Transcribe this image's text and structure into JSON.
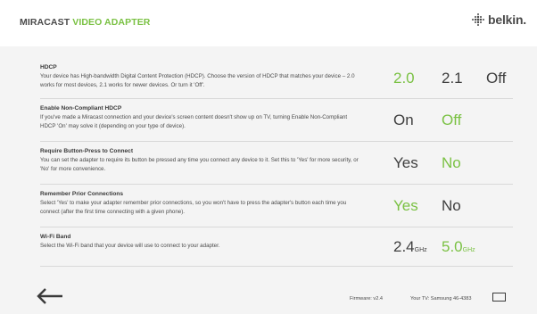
{
  "header": {
    "title_part1": "MIRACAST ",
    "title_part2": "VIDEO ADAPTER",
    "brand": "belkin."
  },
  "colors": {
    "accent": "#7ac143",
    "text": "#4a4a4a",
    "background": "#f4f4f4"
  },
  "settings": [
    {
      "title": "HDCP",
      "description": "Your device has High-bandwidth Digital Content Protection (HDCP). Choose the version of HDCP that matches your device – 2.0 works for most devices, 2.1 works for newer devices. Or turn it 'Off'.",
      "options": [
        {
          "label": "2.0",
          "selected": true
        },
        {
          "label": "2.1",
          "selected": false
        },
        {
          "label": "Off",
          "selected": false
        }
      ]
    },
    {
      "title": "Enable Non-Compliant HDCP",
      "description": "If you've made a Miracast connection and your device's screen content doesn't show up on TV, turning Enable Non-Compliant HDCP 'On' may solve it (depending on your type of device).",
      "options": [
        {
          "label": "On",
          "selected": false
        },
        {
          "label": "Off",
          "selected": true
        }
      ]
    },
    {
      "title": "Require Button-Press to Connect",
      "description": "You can set the adapter to require its button be pressed any time you connect any device to it. Set this to 'Yes' for more security, or 'No' for more convenience.",
      "options": [
        {
          "label": "Yes",
          "selected": false
        },
        {
          "label": "No",
          "selected": true
        }
      ]
    },
    {
      "title": "Remember Prior Connections",
      "description": "Select 'Yes' to make your adapter remember prior connections, so you won't have to press the adapter's button each time you connect (after the first time connecting with a given phone).",
      "options": [
        {
          "label": "Yes",
          "selected": true
        },
        {
          "label": "No",
          "selected": false
        }
      ]
    },
    {
      "title": "Wi-Fi Band",
      "description": "Select the Wi-Fi band that your device will use to connect to your adapter.",
      "options": [
        {
          "label": "2.4",
          "unit": "GHz",
          "selected": false
        },
        {
          "label": "5.0",
          "unit": "GHz",
          "selected": true
        }
      ]
    }
  ],
  "footer": {
    "firmware": "Firmware: v2.4",
    "tv": "Your TV: Samsung 46-4383"
  }
}
